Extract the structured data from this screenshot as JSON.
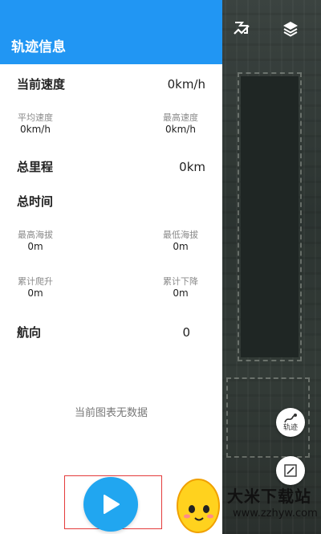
{
  "panel": {
    "title": "轨迹信息",
    "current_speed": {
      "label": "当前速度",
      "value": "0km/h"
    },
    "avg_speed": {
      "label": "平均速度",
      "value": "0km/h"
    },
    "max_speed": {
      "label": "最高速度",
      "value": "0km/h"
    },
    "total_distance": {
      "label": "总里程",
      "value": "0km"
    },
    "total_time": {
      "label": "总时间"
    },
    "max_altitude": {
      "label": "最高海拔",
      "value": "0m"
    },
    "min_altitude": {
      "label": "最低海拔",
      "value": "0m"
    },
    "total_climb": {
      "label": "累计爬升",
      "value": "0m"
    },
    "total_descent": {
      "label": "累计下降",
      "value": "0m"
    },
    "heading": {
      "label": "航向",
      "value": "0"
    },
    "chart_empty": "当前图表无数据"
  },
  "map": {
    "track_button_label": "轨迹"
  },
  "watermark": {
    "name": "大米下载站",
    "url": "www.zzhyw.com"
  },
  "colors": {
    "header_blue": "#2196f3",
    "play_blue": "#21a6f0",
    "highlight_red": "#e43b3b"
  }
}
